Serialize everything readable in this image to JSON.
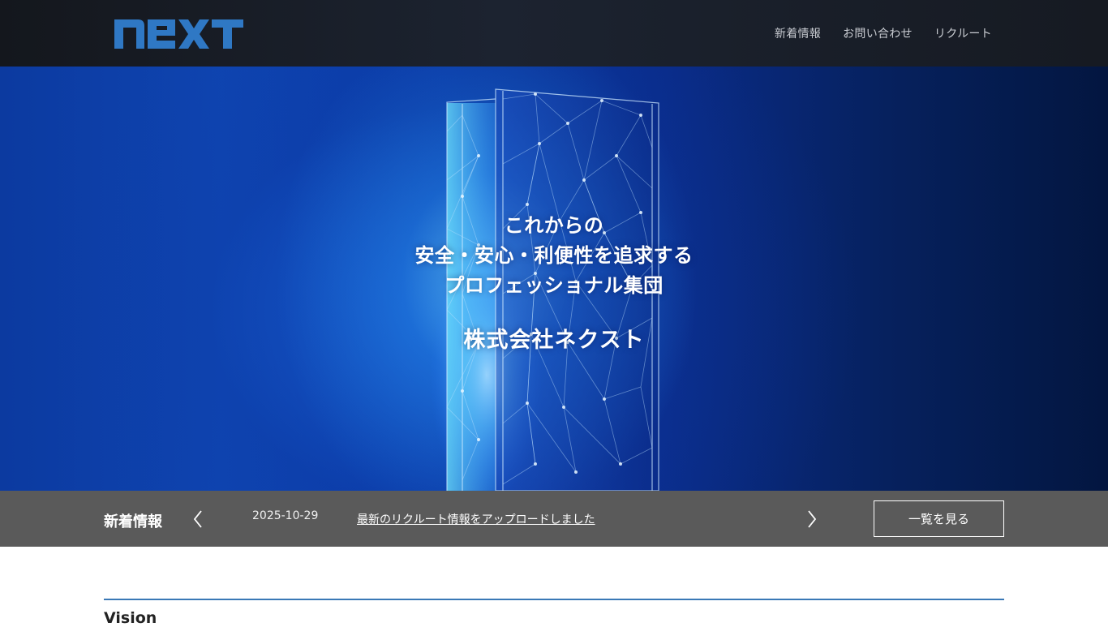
{
  "header": {
    "logo_text": "next",
    "nav": [
      {
        "label": "新着情報"
      },
      {
        "label": "お問い合わせ"
      },
      {
        "label": "リクルート"
      }
    ]
  },
  "hero": {
    "lines": [
      "これからの",
      "安全・安心・利便性を追求する",
      "プロフェッショナル集団"
    ],
    "company": "株式会社ネクスト"
  },
  "news": {
    "heading": "新着情報",
    "prev_icon": "chevron-left-icon",
    "next_icon": "chevron-right-icon",
    "date": "2025-10-29",
    "title": "最新のリクルート情報をアップロードしました",
    "view_all": "一覧を見る"
  },
  "vision": {
    "title": "Vision"
  },
  "colors": {
    "header_bg": "#1a1f28",
    "logo_blue": "#2f78c4",
    "newsbar_bg": "#5a5a5a",
    "rule_blue": "#3a78b6"
  }
}
